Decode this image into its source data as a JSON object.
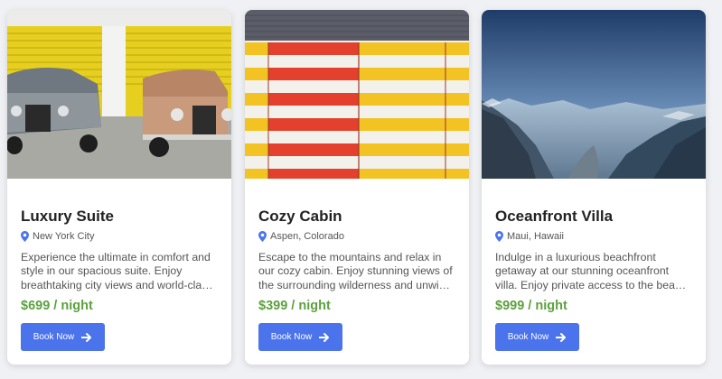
{
  "cards": [
    {
      "image": "vintage-cars-yellow-garage-photo",
      "title": "Luxury Suite",
      "location": "New York City",
      "description": "Experience the ultimate in comfort and style in our spacious suite. Enjoy breathtaking city views and world-class amenities.",
      "price": "$699 / night",
      "button_label": "Book Now",
      "button_icon": "arrow-right-icon"
    },
    {
      "image": "striped-wall-photo",
      "title": "Cozy Cabin",
      "location": "Aspen, Colorado",
      "description": "Escape to the mountains and relax in our cozy cabin. Enjoy stunning views of the surrounding wilderness and unwind by the fire.",
      "price": "$399 / night",
      "button_label": "Book Now",
      "button_icon": "arrow-right-icon"
    },
    {
      "image": "mountain-valley-photo",
      "title": "Oceanfront Villa",
      "location": "Maui, Hawaii",
      "description": "Indulge in a luxurious beachfront getaway at our stunning oceanfront villa. Enjoy private access to the beach and breathtaking sunsets.",
      "price": "$999 / night",
      "button_label": "Book Now",
      "button_icon": "arrow-right-icon"
    }
  ],
  "colors": {
    "accent": "#4a73ec",
    "price": "#5ca13f",
    "location_pin": "#4a73ec"
  }
}
